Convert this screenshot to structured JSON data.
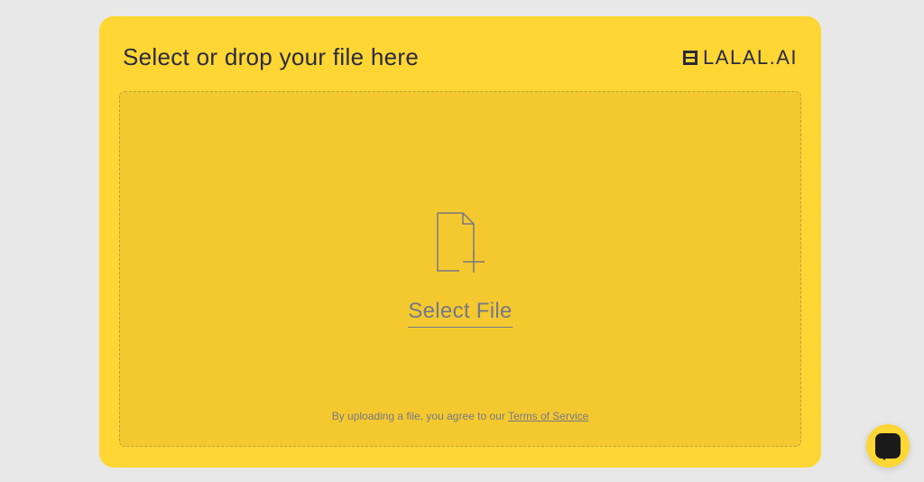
{
  "header": {
    "title": "Select or drop your file here",
    "logo_text": "LALAL.AI"
  },
  "dropzone": {
    "select_label": "Select File",
    "terms_prefix": "By uploading a file, you agree to our ",
    "terms_link": "Terms of Service"
  }
}
